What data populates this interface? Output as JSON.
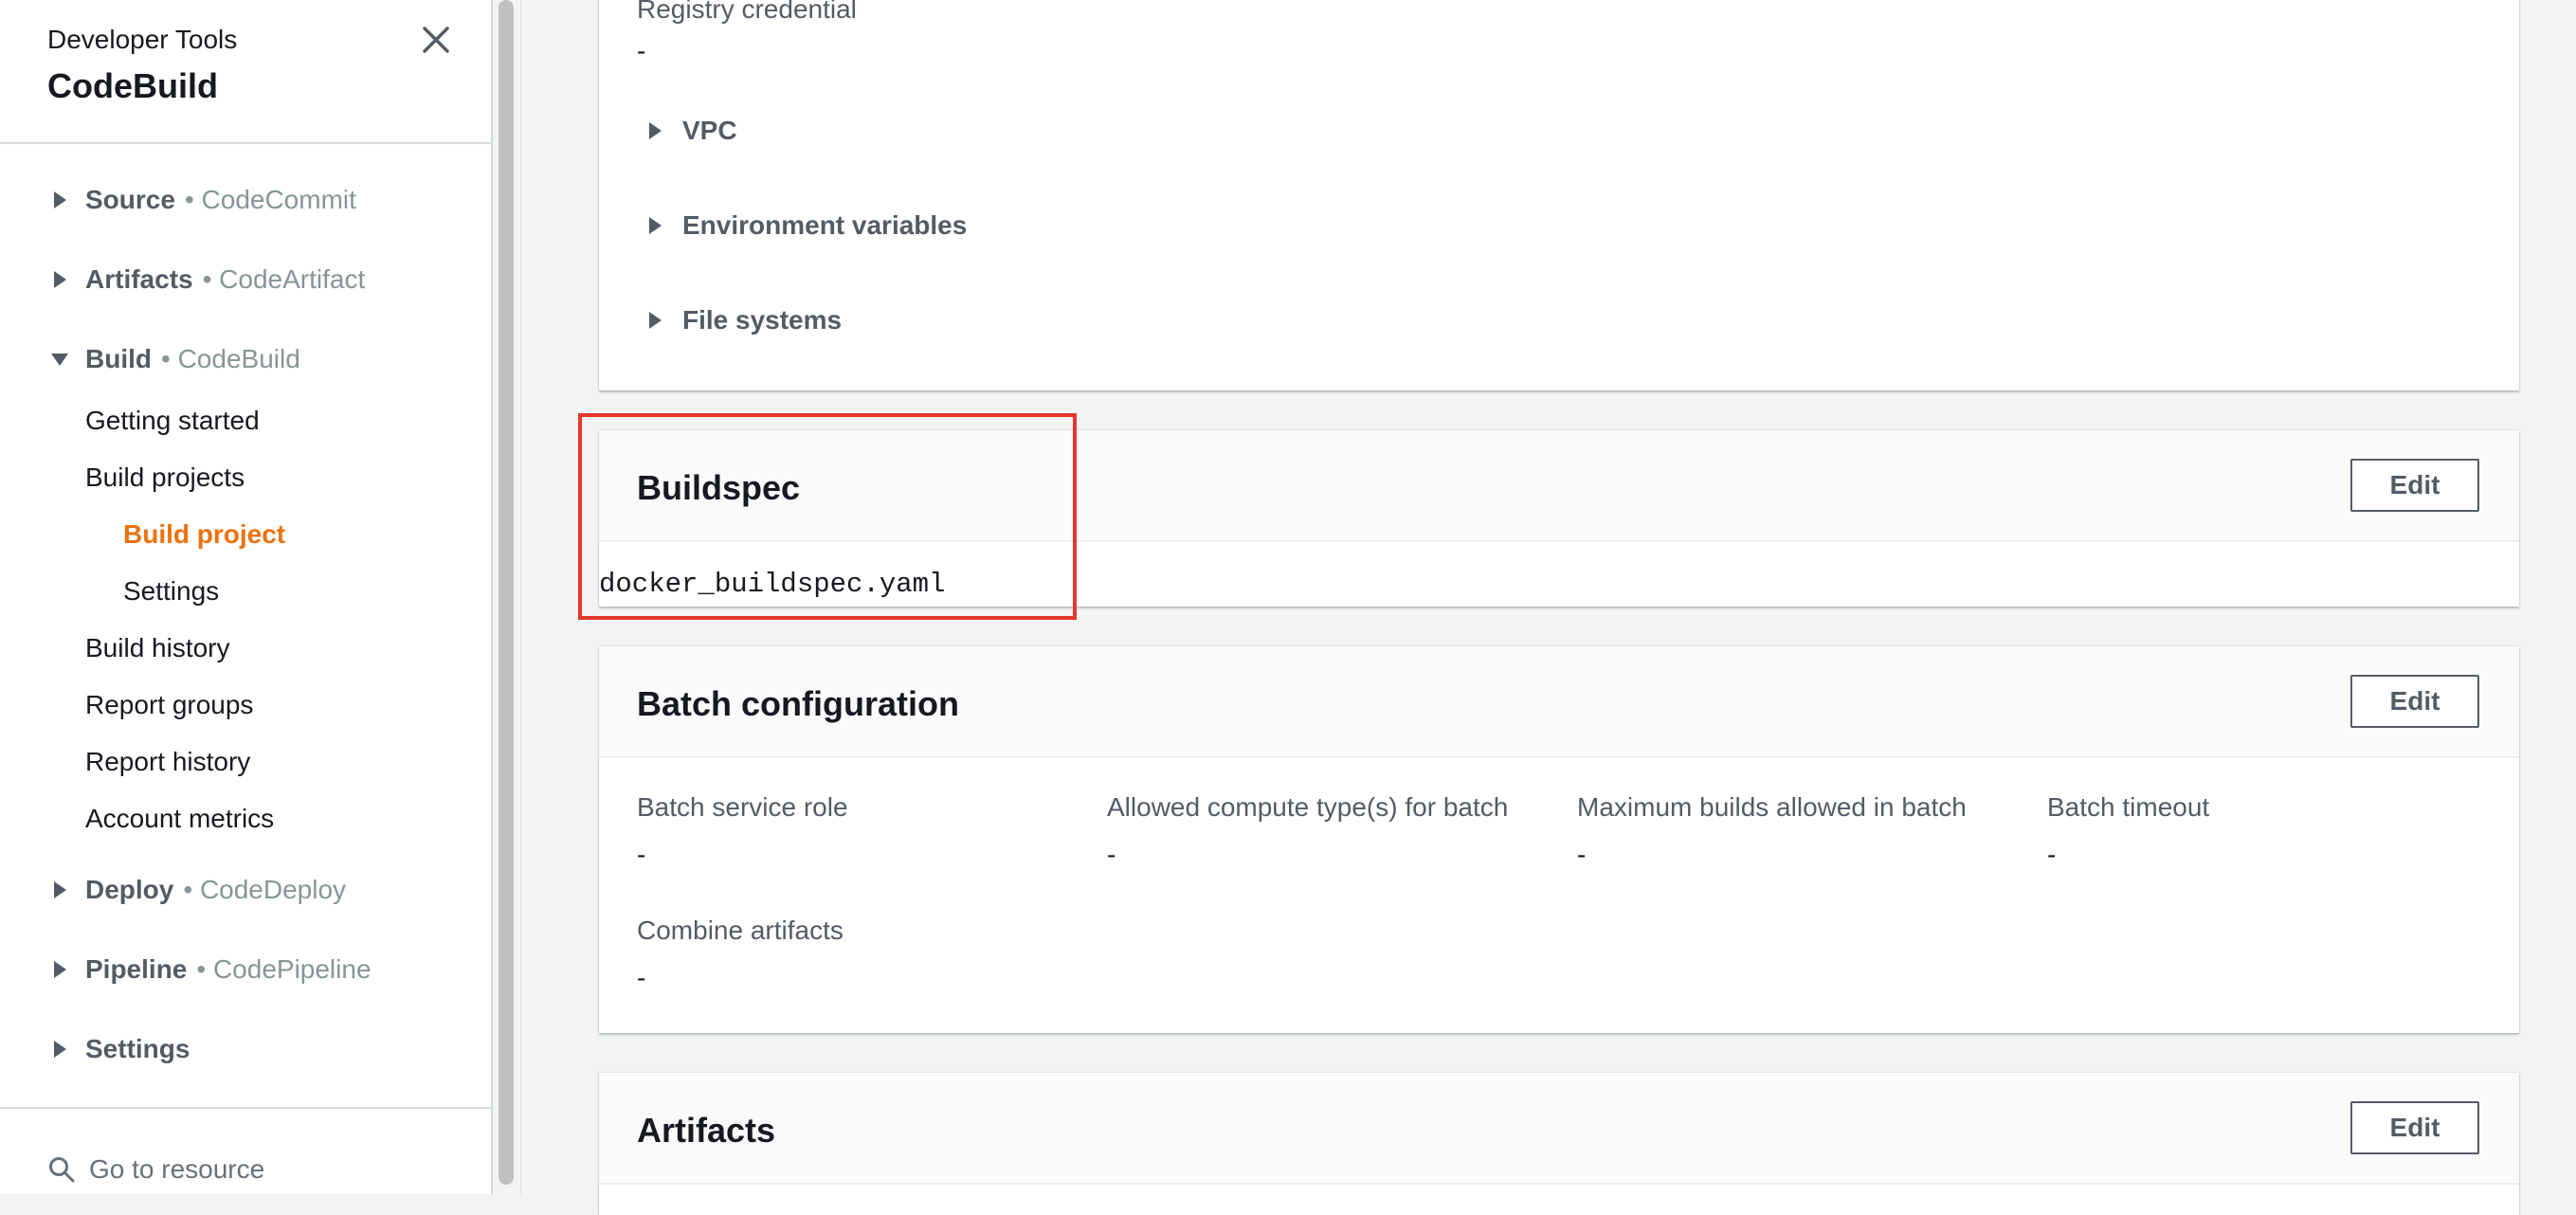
{
  "sidebar": {
    "service": "Developer Tools",
    "title": "CodeBuild",
    "sections": [
      {
        "name": "Source",
        "sub": "• CodeCommit"
      },
      {
        "name": "Artifacts",
        "sub": "• CodeArtifact"
      },
      {
        "name": "Build",
        "sub": "• CodeBuild"
      },
      {
        "name": "Deploy",
        "sub": "• CodeDeploy"
      },
      {
        "name": "Pipeline",
        "sub": "• CodePipeline"
      },
      {
        "name": "Settings",
        "sub": ""
      }
    ],
    "build_items": {
      "getting_started": "Getting started",
      "build_projects": "Build projects",
      "build_project": "Build project",
      "settings": "Settings",
      "build_history": "Build history",
      "report_groups": "Report groups",
      "report_history": "Report history",
      "account_metrics": "Account metrics"
    },
    "go_to_resource": "Go to resource"
  },
  "environment": {
    "registry_credential_label": "Registry credential",
    "registry_credential_value": "-",
    "expanders": [
      "VPC",
      "Environment variables",
      "File systems"
    ]
  },
  "buildspec": {
    "title": "Buildspec",
    "edit_label": "Edit",
    "file": "docker_buildspec.yaml"
  },
  "batch": {
    "title": "Batch configuration",
    "edit_label": "Edit",
    "fields": [
      {
        "label": "Batch service role",
        "value": "-"
      },
      {
        "label": "Allowed compute type(s) for batch",
        "value": "-"
      },
      {
        "label": "Maximum builds allowed in batch",
        "value": "-"
      },
      {
        "label": "Batch timeout",
        "value": "-"
      },
      {
        "label": "Combine artifacts",
        "value": "-"
      }
    ]
  },
  "artifacts": {
    "title": "Artifacts",
    "edit_label": "Edit"
  },
  "colors": {
    "active_nav": "#ec7211",
    "highlight_box": "#e5372d"
  }
}
